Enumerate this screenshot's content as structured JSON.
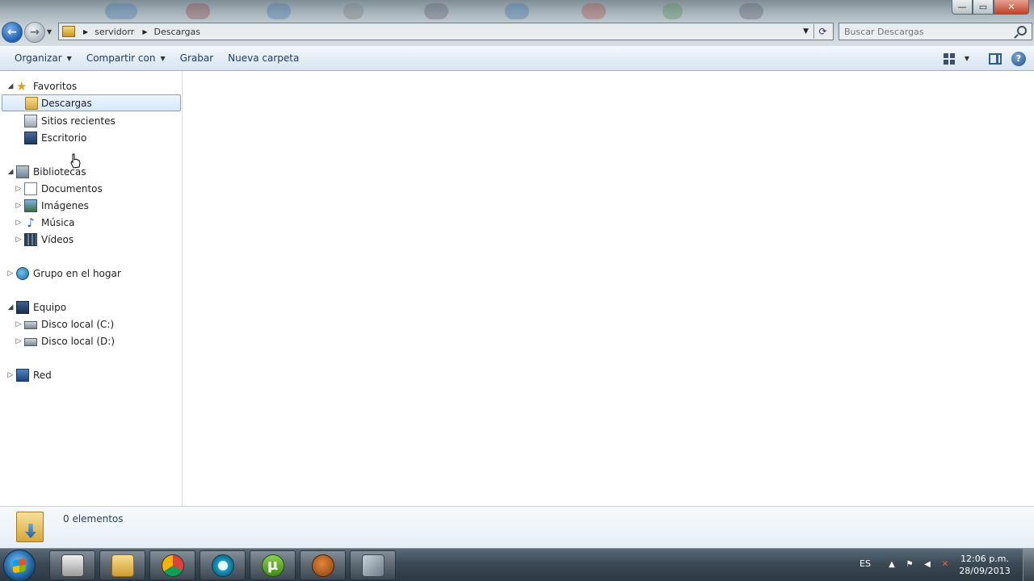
{
  "window": {
    "controls": {
      "minimize": "—",
      "maximize": "▭",
      "close": "✕"
    }
  },
  "address_bar": {
    "crumbs": [
      "servidorr",
      "Descargas"
    ],
    "icon": "folder-icon",
    "refresh_icon": "refresh-icon"
  },
  "search": {
    "placeholder": "Buscar Descargas",
    "icon": "search-icon"
  },
  "toolbar": {
    "organize": "Organizar",
    "share": "Compartir con",
    "burn": "Grabar",
    "new_folder": "Nueva carpeta",
    "help": "?"
  },
  "nav": {
    "favorites": {
      "label": "Favoritos",
      "items": [
        "Descargas",
        "Sitios recientes",
        "Escritorio"
      ]
    },
    "libraries": {
      "label": "Bibliotecas",
      "items": [
        "Documentos",
        "Imágenes",
        "Música",
        "Vídeos"
      ]
    },
    "homegroup": {
      "label": "Grupo en el hogar"
    },
    "computer": {
      "label": "Equipo",
      "items": [
        "Disco local (C:)",
        "Disco local (D:)"
      ]
    },
    "network": {
      "label": "Red"
    },
    "selected": "Descargas"
  },
  "details": {
    "count": "0 elementos"
  },
  "taskbar": {
    "apps": [
      "media-player-icon",
      "explorer-icon",
      "chrome-icon",
      "clock-icon",
      "utorrent-icon",
      "glove-icon",
      "tools-icon"
    ],
    "utorrent_glyph": "µ",
    "language": "ES",
    "time": "12:06 p.m.",
    "date": "28/09/2013"
  }
}
